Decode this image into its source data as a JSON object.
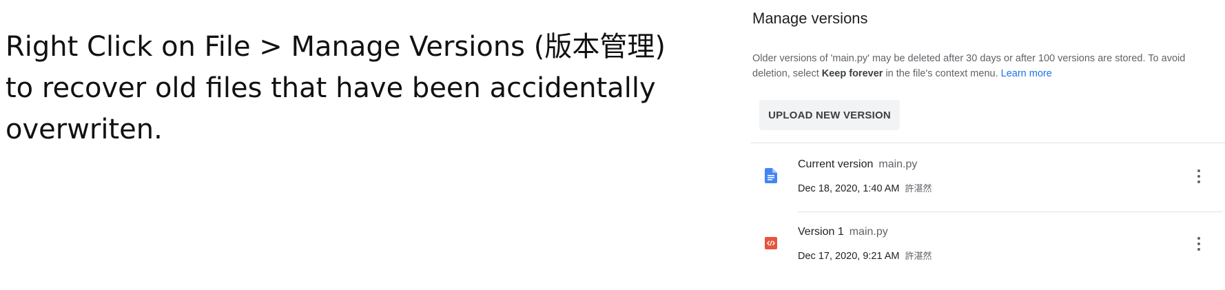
{
  "caption": {
    "line1": "Right Click on File > Manage Versions (版本管理)",
    "line2": "to recover old files that have been accidentally",
    "line3": "overwriten."
  },
  "panel": {
    "title": "Manage versions",
    "description": {
      "part1": "Older versions of 'main.py' may be deleted after 30 days or after 100 versions are stored. To avoid deletion, select ",
      "bold": "Keep forever",
      "part2": " in the file's context menu. ",
      "link": "Learn more"
    },
    "upload_button": "UPLOAD NEW VERSION",
    "versions": [
      {
        "label": "Current version",
        "filename": "main.py",
        "timestamp": "Dec 18, 2020, 1:40 AM",
        "author": "許湛然",
        "icon": "google-doc-icon",
        "icon_color": "#4285f4"
      },
      {
        "label": "Version 1",
        "filename": "main.py",
        "timestamp": "Dec 17, 2020, 9:21 AM",
        "author": "許湛然",
        "icon": "code-file-icon",
        "icon_color": "#e8543c"
      }
    ]
  }
}
